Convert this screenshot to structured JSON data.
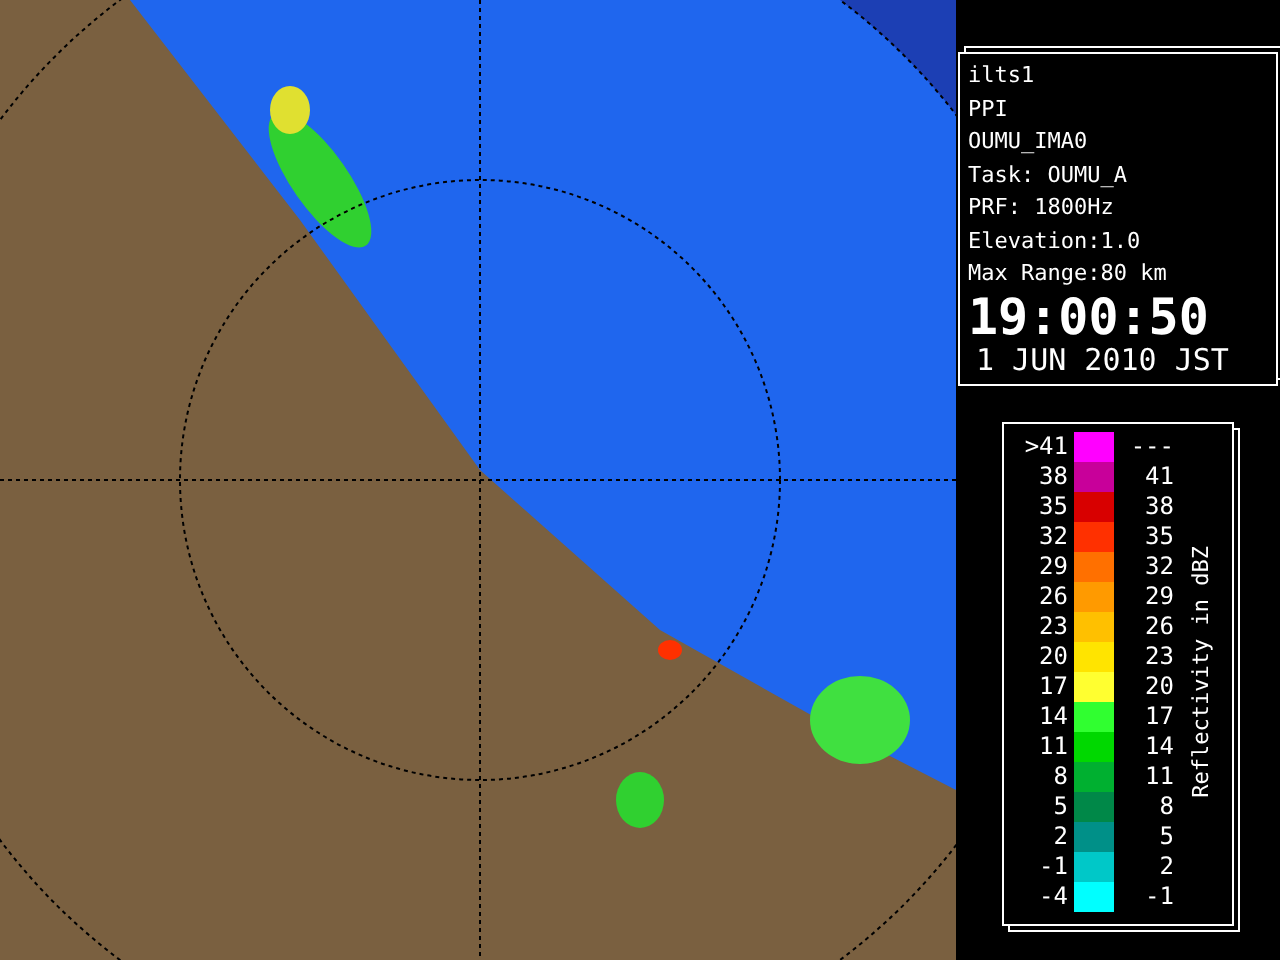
{
  "info_panel": {
    "lines": [
      "ilts1",
      "PPI",
      "OUMU_IMA0",
      "Task: OUMU_A",
      "PRF: 1800Hz",
      "Elevation:1.0",
      "Max Range:80 km"
    ],
    "time": "19:00:50",
    "date": "1 JUN 2010 JST"
  },
  "legend": {
    "title": "Reflectivity in dBZ",
    "rows": [
      {
        "low": ">41",
        "high": "---",
        "color": "#ff00ff"
      },
      {
        "low": "38",
        "high": "41",
        "color": "#c8009a"
      },
      {
        "low": "35",
        "high": "38",
        "color": "#d80000"
      },
      {
        "low": "32",
        "high": "35",
        "color": "#ff3000"
      },
      {
        "low": "29",
        "high": "32",
        "color": "#ff7000"
      },
      {
        "low": "26",
        "high": "29",
        "color": "#ff9a00"
      },
      {
        "low": "23",
        "high": "26",
        "color": "#ffc000"
      },
      {
        "low": "20",
        "high": "23",
        "color": "#ffe400"
      },
      {
        "low": "17",
        "high": "20",
        "color": "#ffff30"
      },
      {
        "low": "14",
        "high": "17",
        "color": "#30ff30"
      },
      {
        "low": "11",
        "high": "14",
        "color": "#00d800"
      },
      {
        "low": "8",
        "high": "11",
        "color": "#00b030"
      },
      {
        "low": "5",
        "high": "8",
        "color": "#008848"
      },
      {
        "low": "2",
        "high": "5",
        "color": "#009088"
      },
      {
        "low": "-1",
        "high": "2",
        "color": "#00c8c8"
      },
      {
        "low": "-4",
        "high": "-1",
        "color": "#00ffff"
      }
    ]
  }
}
